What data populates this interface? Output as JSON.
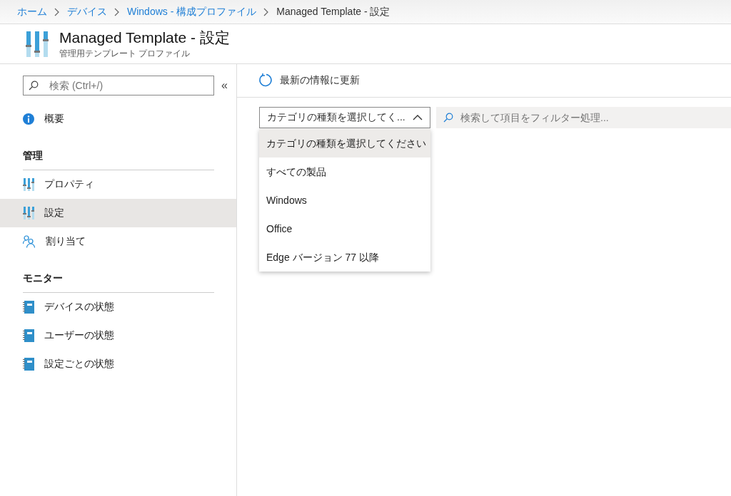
{
  "breadcrumb": [
    {
      "label": "ホーム",
      "link": true
    },
    {
      "label": "デバイス",
      "link": true
    },
    {
      "label": "Windows - 構成プロファイル",
      "link": true
    },
    {
      "label": "Managed Template - 設定",
      "link": false
    }
  ],
  "header": {
    "title": "Managed Template - 設定",
    "subtitle": "管理用テンプレート プロファイル"
  },
  "sidebar": {
    "search": {
      "placeholder": "検索 (Ctrl+/)"
    },
    "collapse": "«",
    "top_items": [
      {
        "label": "概要",
        "kind": "info",
        "selected": false
      }
    ],
    "sections": [
      {
        "heading": "管理",
        "items": [
          {
            "label": "プロパティ",
            "kind": "sliders",
            "selected": false
          },
          {
            "label": "設定",
            "kind": "sliders",
            "selected": true
          },
          {
            "label": "割り当て",
            "kind": "people",
            "selected": false
          }
        ]
      },
      {
        "heading": "モニター",
        "items": [
          {
            "label": "デバイスの状態",
            "kind": "notebook",
            "selected": false
          },
          {
            "label": "ユーザーの状態",
            "kind": "notebook",
            "selected": false
          },
          {
            "label": "設定ごとの状態",
            "kind": "notebook",
            "selected": false
          }
        ]
      }
    ]
  },
  "toolbar": {
    "refresh": "最新の情報に更新"
  },
  "category_dropdown": {
    "value": "カテゴリの種類を選択してく...",
    "expanded": true,
    "options": [
      {
        "label": "カテゴリの種類を選択してください",
        "selected": true
      },
      {
        "label": "すべての製品",
        "selected": false
      },
      {
        "label": "Windows",
        "selected": false
      },
      {
        "label": "Office",
        "selected": false
      },
      {
        "label": "Edge バージョン 77 以降",
        "selected": false
      }
    ]
  },
  "filter": {
    "placeholder": "検索して項目をフィルター処理..."
  }
}
